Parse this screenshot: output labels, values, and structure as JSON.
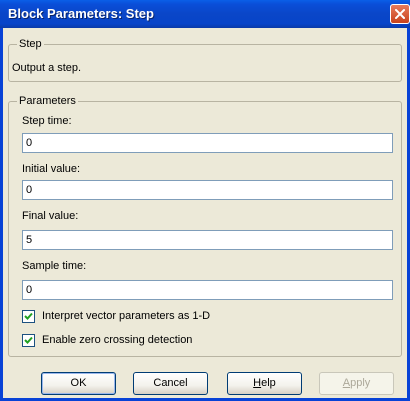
{
  "window": {
    "title": "Block Parameters: Step"
  },
  "step_group": {
    "label": "Step",
    "description": "Output a step."
  },
  "parameters_group": {
    "label": "Parameters",
    "fields": [
      {
        "label": "Step time:",
        "value": "0"
      },
      {
        "label": "Initial value:",
        "value": "0"
      },
      {
        "label": "Final value:",
        "value": "5"
      },
      {
        "label": "Sample time:",
        "value": "0"
      }
    ],
    "checkboxes": [
      {
        "label": "Interpret vector parameters as 1-D",
        "checked": true
      },
      {
        "label": "Enable zero crossing detection",
        "checked": true
      }
    ]
  },
  "buttons": {
    "ok": "OK",
    "cancel": "Cancel",
    "help_first": "H",
    "help_rest": "elp",
    "apply_first": "A",
    "apply_rest": "pply"
  },
  "colors": {
    "titlebar": "#0a46c8",
    "dialog_bg": "#ece9d8",
    "close_button": "#c8421c"
  },
  "icons": {
    "close": "close-icon",
    "check": "checkmark-icon"
  }
}
